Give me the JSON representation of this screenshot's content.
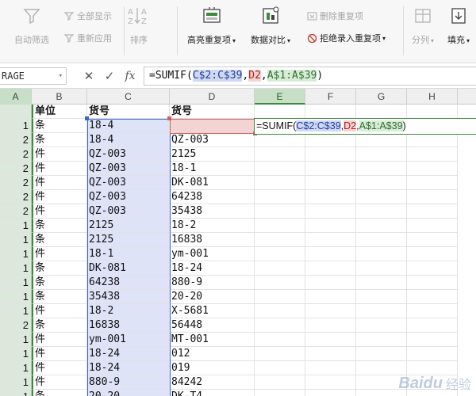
{
  "ribbon": {
    "autofilter_label": "自动筛选",
    "show_all_label": "全部显示",
    "reapply_label": "重新应用",
    "sort_label": "排序",
    "highlight_dup_label": "高亮重复项",
    "compare_label": "数据对比",
    "delete_dup_label": "删除重复项",
    "reject_dup_label": "拒绝录入重复项",
    "split_label": "分列",
    "fill_label": "填充"
  },
  "formula_bar": {
    "name_box": "RAGE",
    "formula_prefix": "=SUMIF(",
    "ref1": "C$2:C$39",
    "sep1": ",",
    "ref2": "D2",
    "sep2": ",",
    "ref3": "A$1:A$39",
    "formula_suffix": ")"
  },
  "columns": [
    "A",
    "B",
    "C",
    "D",
    "E",
    "F",
    "G",
    "H"
  ],
  "header_row": {
    "b": "单位",
    "c": "货号",
    "d": "货号"
  },
  "editing_cell": {
    "prefix": "=SUMIF(",
    "ref1": "C$2:C$39",
    "sep1": ",",
    "ref2": "D2",
    "sep2": ",",
    "ref3": "A$1:A$39",
    "suffix": ")"
  },
  "rows": [
    {
      "a": "1",
      "b": "条",
      "c": "18-4",
      "d": "18-4"
    },
    {
      "a": "2",
      "b": "条",
      "c": "18-4",
      "d": "QZ-003"
    },
    {
      "a": "2",
      "b": "件",
      "c": "QZ-003",
      "d": "2125"
    },
    {
      "a": "2",
      "b": "件",
      "c": "QZ-003",
      "d": "18-1"
    },
    {
      "a": "2",
      "b": "件",
      "c": "QZ-003",
      "d": "DK-081"
    },
    {
      "a": "2",
      "b": "件",
      "c": "QZ-003",
      "d": "64238"
    },
    {
      "a": "2",
      "b": "件",
      "c": "QZ-003",
      "d": "35438"
    },
    {
      "a": "1",
      "b": "条",
      "c": "2125",
      "d": "18-2"
    },
    {
      "a": "1",
      "b": "条",
      "c": "2125",
      "d": "16838"
    },
    {
      "a": "1",
      "b": "件",
      "c": "18-1",
      "d": "ym-001"
    },
    {
      "a": "1",
      "b": "条",
      "c": "DK-081",
      "d": "18-24"
    },
    {
      "a": "1",
      "b": "条",
      "c": "64238",
      "d": "880-9"
    },
    {
      "a": "1",
      "b": "条",
      "c": "35438",
      "d": "20-20"
    },
    {
      "a": "1",
      "b": "件",
      "c": "18-2",
      "d": "X-5681"
    },
    {
      "a": "2",
      "b": "条",
      "c": "16838",
      "d": "56448"
    },
    {
      "a": "1",
      "b": "件",
      "c": "ym-001",
      "d": "MT-001"
    },
    {
      "a": "1",
      "b": "件",
      "c": "18-24",
      "d": "012"
    },
    {
      "a": "1",
      "b": "件",
      "c": "18-24",
      "d": "019"
    },
    {
      "a": "1",
      "b": "件",
      "c": "880-9",
      "d": "84242"
    },
    {
      "a": "1",
      "b": "条",
      "c": "20-20",
      "d": "DK-T4"
    }
  ],
  "watermark": {
    "text": "Baidu",
    "cn": "经验"
  }
}
